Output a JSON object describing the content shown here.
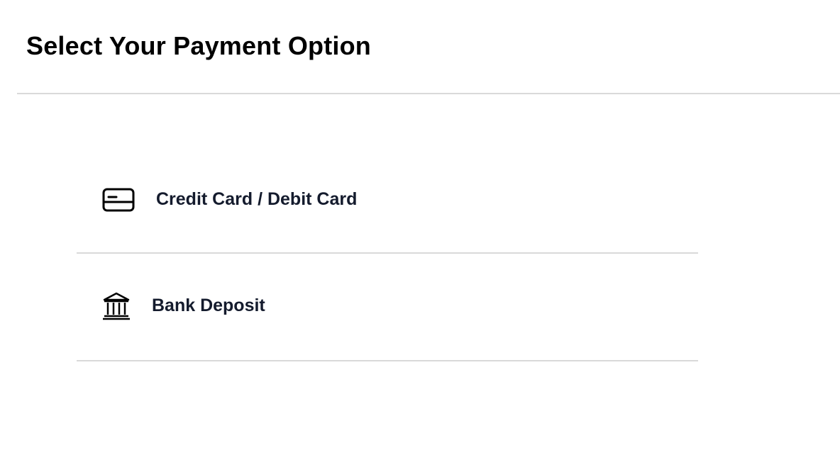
{
  "page": {
    "title": "Select Your Payment Option"
  },
  "payment_options": [
    {
      "label": "Credit Card / Debit Card",
      "icon": "credit-card-icon"
    },
    {
      "label": "Bank Deposit",
      "icon": "bank-icon"
    }
  ],
  "colors": {
    "title_text": "#000000",
    "option_text": "#141b2d",
    "divider": "#d9d9d9",
    "background": "#ffffff"
  }
}
